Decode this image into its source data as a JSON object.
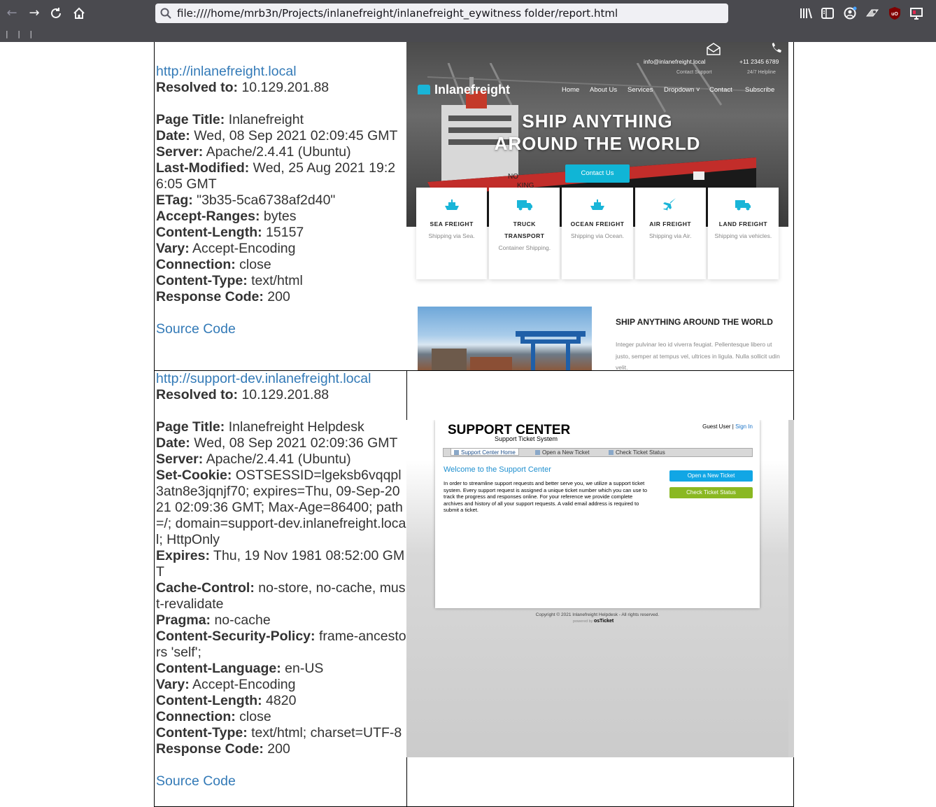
{
  "browser": {
    "url": "file:////home/mrb3n/Projects/inlanefreight/inlanefreight_eywitness folder/report.html",
    "bookmarks_strip": "| | |"
  },
  "rows": [
    {
      "url": "http://inlanefreight.local",
      "resolved_label": "Resolved to:",
      "resolved_value": "10.129.201.88",
      "headers": [
        {
          "key": "Page Title:",
          "value": "Inlanefreight"
        },
        {
          "key": "Date:",
          "value": "Wed, 08 Sep 2021 02:09:45 GMT"
        },
        {
          "key": "Server:",
          "value": "Apache/2.4.41 (Ubuntu)"
        },
        {
          "key": "Last-Modified:",
          "value": "Wed, 25 Aug 2021 19:26:05 GMT"
        },
        {
          "key": "ETag:",
          "value": "\"3b35-5ca6738af2d40\""
        },
        {
          "key": "Accept-Ranges:",
          "value": "bytes"
        },
        {
          "key": "Content-Length:",
          "value": "15157"
        },
        {
          "key": "Vary:",
          "value": "Accept-Encoding"
        },
        {
          "key": "Connection:",
          "value": "close"
        },
        {
          "key": "Content-Type:",
          "value": "text/html"
        },
        {
          "key": "Response Code:",
          "value": "200"
        }
      ],
      "source_link": "Source Code"
    },
    {
      "url": "http://support-dev.inlanefreight.local",
      "resolved_label": "Resolved to:",
      "resolved_value": "10.129.201.88",
      "headers": [
        {
          "key": "Page Title:",
          "value": "Inlanefreight Helpdesk"
        },
        {
          "key": "Date:",
          "value": "Wed, 08 Sep 2021 02:09:36 GMT"
        },
        {
          "key": "Server:",
          "value": "Apache/2.4.41 (Ubuntu)"
        },
        {
          "key": "Set-Cookie:",
          "value": "OSTSESSID=lgeksb6vqqpl3atn8e3jqnjf70; expires=Thu, 09-Sep-2021 02:09:36 GMT; Max-Age=86400; path=/; domain=support-dev.inlanefreight.local; HttpOnly"
        },
        {
          "key": "Expires:",
          "value": "Thu, 19 Nov 1981 08:52:00 GMT"
        },
        {
          "key": "Cache-Control:",
          "value": "no-store, no-cache, must-revalidate"
        },
        {
          "key": "Pragma:",
          "value": "no-cache"
        },
        {
          "key": "Content-Security-Policy:",
          "value": "frame-ancestors 'self';"
        },
        {
          "key": "Content-Language:",
          "value": "en-US"
        },
        {
          "key": "Vary:",
          "value": "Accept-Encoding"
        },
        {
          "key": "Content-Length:",
          "value": "4820"
        },
        {
          "key": "Connection:",
          "value": "close"
        },
        {
          "key": "Content-Type:",
          "value": "text/html; charset=UTF-8"
        },
        {
          "key": "Response Code:",
          "value": "200"
        }
      ],
      "source_link": "Source Code"
    }
  ],
  "shot1": {
    "logo": "Inlanefreight",
    "email": "info@inlanefreight.local",
    "email_sub": "Contact Support",
    "phone": "+11 2345 6789",
    "phone_sub": "24/7 Helpline",
    "menu": [
      "Home",
      "About Us",
      "Services",
      "Dropdown ˅",
      "Contact",
      "Subscribe"
    ],
    "headline_1": "SHIP ANYTHING",
    "headline_2": "AROUND THE WORLD",
    "contact_btn": "Contact Us",
    "services": [
      {
        "title_1": "SEA FREIGHT",
        "title_2": "",
        "desc": "Shipping via Sea.",
        "icon": "ship-icon"
      },
      {
        "title_1": "TRUCK",
        "title_2": "TRANSPORT",
        "desc": "Container Shipping.",
        "icon": "truck-icon"
      },
      {
        "title_1": "OCEAN FREIGHT",
        "title_2": "",
        "desc": "Shipping via Ocean.",
        "icon": "ship-icon"
      },
      {
        "title_1": "AIR FREIGHT",
        "title_2": "",
        "desc": "Shipping via Air.",
        "icon": "plane-icon"
      },
      {
        "title_1": "LAND FREIGHT",
        "title_2": "",
        "desc": "Shipping via vehicles.",
        "icon": "truck-icon"
      }
    ],
    "about_title": "SHIP ANYTHING AROUND THE WORLD",
    "about_text": "Integer pulvinar leo id viverra feugiat. Pellentesque libero ut justo, semper at tempus vel, ultrices in ligula. Nulla sollicit udin velit."
  },
  "shot2": {
    "title": "SUPPORT CENTER",
    "subtitle": "Support Ticket System",
    "guest": "Guest User",
    "sep": " | ",
    "sign_in": "Sign In",
    "nav": [
      "Support Center Home",
      "Open a New Ticket",
      "Check Ticket Status"
    ],
    "welcome": "Welcome to the Support Center",
    "body": "In order to streamline support requests and better serve you, we utilize a support ticket system. Every support request is assigned a unique ticket number which you can use to track the progress and responses online. For your reference we provide complete archives and history of all your support requests. A valid email address is required to submit a ticket.",
    "btn_open": "Open a New Ticket",
    "btn_check": "Check Ticket Status",
    "footer": "Copyright © 2021 Inlanefreight Helpdesk - All rights reserved.",
    "powered": "powered by",
    "powered_brand": "osTicket"
  }
}
